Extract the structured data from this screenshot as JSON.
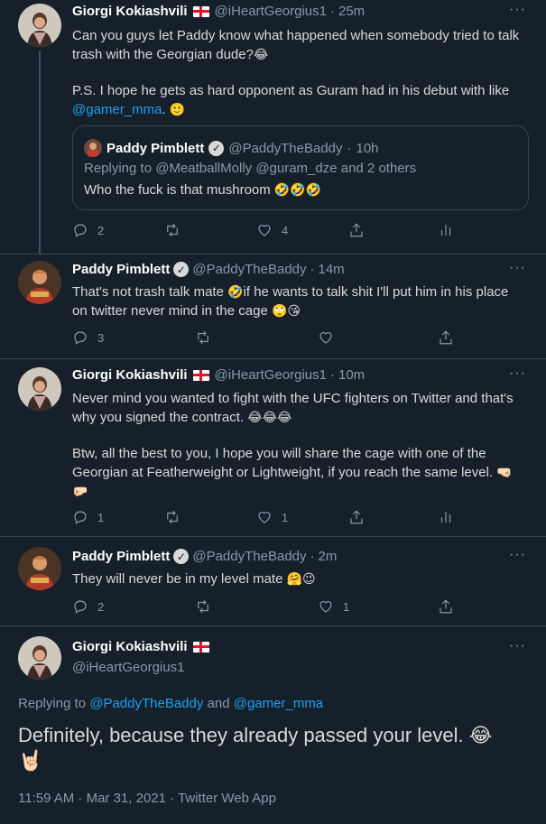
{
  "colors": {
    "background": "#15202b",
    "border": "#38444d",
    "link": "#1da1f2",
    "muted": "#8899a6"
  },
  "tweets": [
    {
      "name": "Giorgi Kokiashvili",
      "handle": "@iHeartGeorgius1",
      "time": "25m",
      "line1": "Can you guys let Paddy know what happened when somebody tried to talk",
      "line2": "trash with the Georgian dude?",
      "line3": "P.S. I hope he gets as hard opponent as Guram had in his debut with like",
      "mention": "@gamer_mma",
      "mention_suffix": ".",
      "quote": {
        "name": "Paddy Pimblett",
        "handle": "@PaddyTheBaddy",
        "time": "10h",
        "replying_prefix": "Replying to ",
        "replying_to": "@MeatballMolly @guram_dze and 2 others",
        "text": "Who the fuck is that mushroom"
      },
      "replies": "2",
      "likes": "4"
    },
    {
      "name": "Paddy Pimblett",
      "handle": "@PaddyTheBaddy",
      "time": "14m",
      "line1a": "That's not trash talk mate",
      "line1b": "if he wants to talk shit I'll put him in his place",
      "line2": "on twitter never mind in the cage",
      "replies": "3"
    },
    {
      "name": "Giorgi Kokiashvili",
      "handle": "@iHeartGeorgius1",
      "time": "10m",
      "line1": "Never mind you wanted to fight with the UFC fighters on Twitter and that's",
      "line2": "why you signed the contract.",
      "line3": "Btw, all the best to you, I hope you will share the cage with one of the",
      "line4": "Georgian at Featherweight or Lightweight, if you reach the same level.",
      "replies": "1",
      "likes": "1"
    },
    {
      "name": "Paddy Pimblett",
      "handle": "@PaddyTheBaddy",
      "time": "2m",
      "line1": "They will never be in my level mate",
      "replies": "2",
      "likes": "1"
    }
  ],
  "main_tweet": {
    "name": "Giorgi Kokiashvili",
    "handle": "@iHeartGeorgius1",
    "replying_prefix": "Replying to ",
    "replying_to_1": "@PaddyTheBaddy",
    "replying_and": " and ",
    "replying_to_2": "@gamer_mma",
    "text": "Definitely, because they already passed your level.",
    "meta": "11:59 AM · Mar 31, 2021 · Twitter Web App"
  },
  "ui": {
    "dot": "·",
    "more": "···"
  },
  "icons": [
    "reply-icon",
    "retweet-icon",
    "like-icon",
    "share-icon",
    "analytics-icon",
    "more-icon",
    "verified-icon",
    "georgia-flag-icon"
  ]
}
